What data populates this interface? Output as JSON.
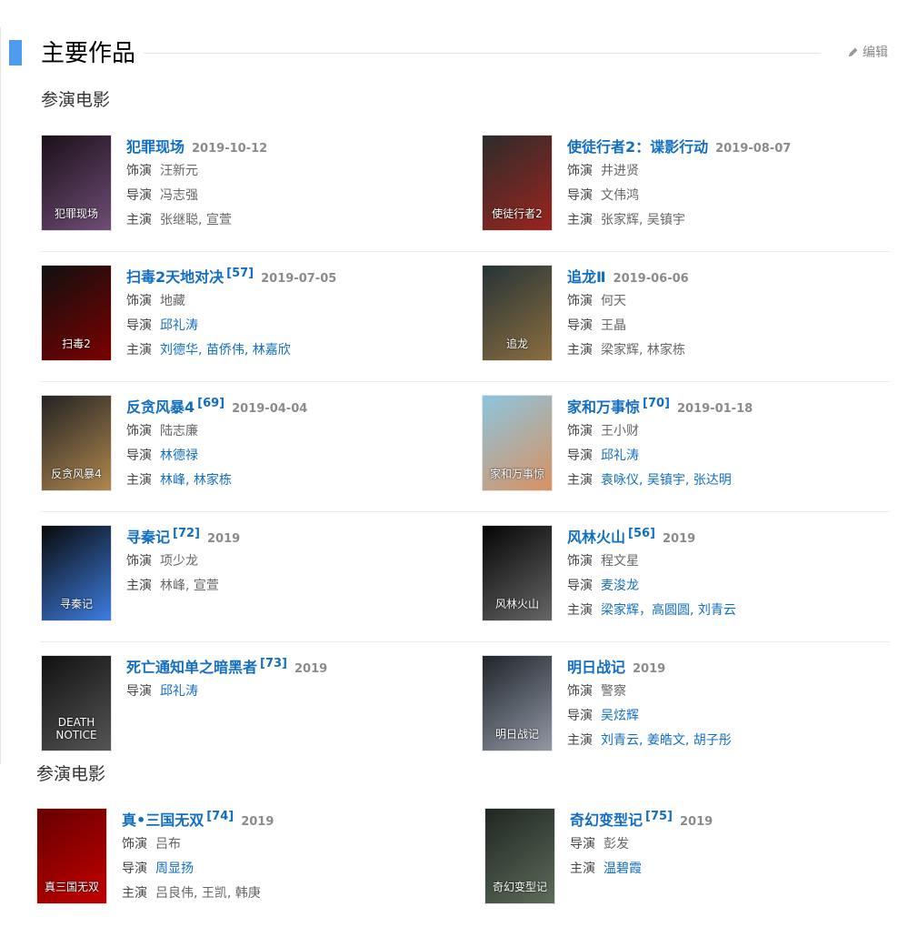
{
  "header": {
    "title": "主要作品",
    "edit": "编辑"
  },
  "sections": [
    "参演电影",
    "参演电影"
  ],
  "movies": [
    {
      "title": "犯罪现场",
      "sup": "",
      "year": "2019-10-12",
      "lines": [
        [
          "饰演",
          "汪新元"
        ],
        [
          "导演",
          "冯志强"
        ],
        [
          "主演",
          "张继聪, 宣萱"
        ]
      ]
    },
    {
      "title": "使徒行者2：谍影行动",
      "sup": "",
      "year": "2019-08-07",
      "lines": [
        [
          "饰演",
          "井进贤"
        ],
        [
          "导演",
          "文伟鸿"
        ],
        [
          "主演",
          "张家辉, 吴镇宇"
        ]
      ]
    },
    {
      "title": "扫毒2天地对决",
      "sup": "[57]",
      "year": "2019-07-05",
      "lines": [
        [
          "饰演",
          "地藏"
        ],
        [
          "导演",
          "邱礼涛"
        ],
        [
          "主演",
          "刘德华, 苗侨伟, 林嘉欣"
        ]
      ]
    },
    {
      "title": "追龙Ⅱ",
      "sup": "",
      "year": "2019-06-06",
      "lines": [
        [
          "饰演",
          "何天"
        ],
        [
          "导演",
          "王晶"
        ],
        [
          "主演",
          "梁家辉, 林家栋"
        ]
      ]
    },
    {
      "title": "反贪风暴4",
      "sup": "[69]",
      "year": "2019-04-04",
      "lines": [
        [
          "饰演",
          "陆志廉"
        ],
        [
          "导演",
          "林德禄"
        ],
        [
          "主演",
          "林峰, 林家栋"
        ]
      ]
    },
    {
      "title": "家和万事惊",
      "sup": "[70]",
      "year": "2019-01-18",
      "lines": [
        [
          "饰演",
          "王小财"
        ],
        [
          "导演",
          "邱礼涛"
        ],
        [
          "主演",
          "袁咏仪, 吴镇宇, 张达明"
        ]
      ]
    },
    {
      "title": "寻秦记",
      "sup": "[72]",
      "year": "2019",
      "lines": [
        [
          "饰演",
          "项少龙"
        ],
        [
          "主演",
          "林峰, 宣萱"
        ]
      ]
    },
    {
      "title": "风林火山",
      "sup": "[56]",
      "year": "2019",
      "lines": [
        [
          "饰演",
          "程文星"
        ],
        [
          "导演",
          "麦浚龙"
        ],
        [
          "主演",
          "梁家辉，高圆圆, 刘青云"
        ]
      ]
    },
    {
      "title": "死亡通知单之暗黑者",
      "sup": "[73]",
      "year": "2019",
      "lines": [
        [
          "导演",
          "邱礼涛"
        ]
      ]
    },
    {
      "title": "明日战记",
      "sup": "",
      "year": "2019",
      "lines": [
        [
          "饰演",
          "警察"
        ],
        [
          "导演",
          "吴炫辉"
        ],
        [
          "主演",
          "刘青云, 姜皓文, 胡子彤"
        ]
      ]
    },
    {
      "title": "真•三国无双",
      "sup": "[74]",
      "year": "2019",
      "lines": [
        [
          "饰演",
          "吕布"
        ],
        [
          "导演",
          "周显扬"
        ],
        [
          "主演",
          "吕良伟, 王凯, 韩庚"
        ]
      ]
    },
    {
      "title": "奇幻变型记",
      "sup": "[75]",
      "year": "2019",
      "lines": [
        [
          "导演",
          "彭发"
        ],
        [
          "主演",
          "温碧霞"
        ]
      ]
    }
  ],
  "posters": [
    {
      "text": "犯罪现场",
      "c1": "#1b1018",
      "c2": "#6f4d77"
    },
    {
      "text": "使徒行者2",
      "c1": "#2d2c2b",
      "c2": "#9b241e"
    },
    {
      "text": "扫毒2",
      "c1": "#101010",
      "c2": "#7c0000"
    },
    {
      "text": "追龙",
      "c1": "#263437",
      "c2": "#8b6d3f"
    },
    {
      "text": "反贪风暴4",
      "c1": "#232323",
      "c2": "#b0874f"
    },
    {
      "text": "家和万事惊",
      "c1": "#8cc5df",
      "c2": "#d99161"
    },
    {
      "text": "寻秦记",
      "c1": "#090909",
      "c2": "#3e7de0"
    },
    {
      "text": "风林火山",
      "c1": "#050505",
      "c2": "#666666"
    },
    {
      "text": "DEATH NOTICE",
      "c1": "#111111",
      "c2": "#555555"
    },
    {
      "text": "明日战记",
      "c1": "#20252b",
      "c2": "#9198a5"
    },
    {
      "text": "真三国无双",
      "c1": "#650000",
      "c2": "#c40000"
    },
    {
      "text": "奇幻变型记",
      "c1": "#1f2622",
      "c2": "#5d6c59"
    }
  ]
}
